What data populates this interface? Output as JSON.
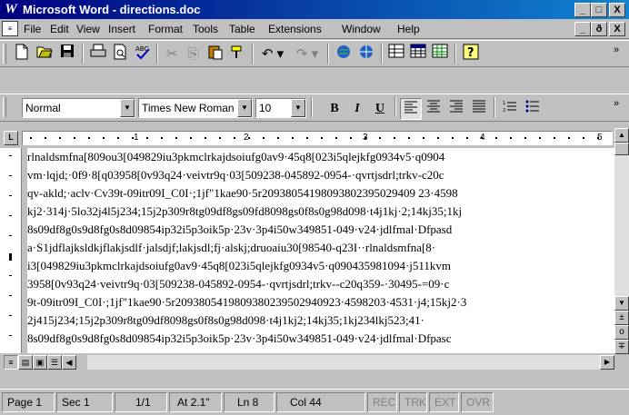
{
  "window": {
    "app_icon_glyph": "W",
    "title": "Microsoft Word - directions.doc",
    "title_buttons": {
      "minimize": "_",
      "maximize": "□",
      "close": "X"
    }
  },
  "menubar": {
    "items": [
      "File",
      "Edit",
      "View",
      "Insert",
      "Format",
      "Tools",
      "Table",
      "Extensions",
      "Window",
      "Help"
    ],
    "doc_buttons": {
      "minimize": "_",
      "restore": "ð",
      "close": "X"
    }
  },
  "standard_toolbar": {
    "icons": [
      "new-document-icon",
      "open-folder-icon",
      "save-disk-icon",
      "print-icon",
      "print-preview-icon",
      "spelling-check-icon",
      "cut-icon",
      "copy-icon",
      "paste-icon",
      "format-painter-icon",
      "undo-icon",
      "redo-icon",
      "insert-hyperlink-icon",
      "web-toolbar-icon",
      "tables-borders-icon",
      "insert-table-icon",
      "insert-excel-icon",
      "help-icon"
    ],
    "overflow": "»"
  },
  "formatting_toolbar": {
    "style": "Normal",
    "font": "Times New Roman",
    "size": "10",
    "bold": "B",
    "italic": "I",
    "underline": "U",
    "overflow": "»"
  },
  "ruler": {
    "numbers": [
      "1",
      "2",
      "3",
      "4",
      "5"
    ]
  },
  "document": {
    "lines": [
      "rlnaldsmfna[809ou3[049829iu3pkmclrkajdsoiufg0av9·45q8[023i5qlejkfg0934v5·q0904",
      "vm·lqjd;·0f9·8[q03958[0v93q24·veivtr9q·03[509238-045892-0954-·qvrtjsdrl;trkv-c20c",
      "qv-akld;·aclv·Cv39t-09itr09I_C0I·;1jf\"1kae90·5r20938054198093802395029409 23·4598",
      "kj2·314j·5lo32j4l5j234;15j2p309r8tg09df8gs09fd8098gs0f8s0g98d098·t4j1kj·2;14kj35;1kj",
      "8s09df8g0s9d8fg0s8d09854ip32i5p3oik5p·23v·3p4i50w349851-049·v24·jdlfmal·Dfpasd",
      "a·S1jdflajksldkjflakjsdlf·jalsdjf;lakjsdl;fj·alskj;druoaiu30[98540-q23I··rlnaldsmfna[8·",
      "i3[049829iu3pkmclrkajdsoiufg0av9·45q8[023i5qlejkfg0934v5·q090435981094·j511kvm",
      "3958[0v93q24·veivtr9q·03[509238-045892-0954-·qvrtjsdrl;trkv--c20q359-·30495-=09·c",
      "9t-09itr09I_C0I·;1jf\"1kae90·5r2093805419809380239502940923·4598203·4531·j4;15kj2·3",
      "2j415j234;15j2p309r8tg09df8098gs0f8s0g98d098·t4j1kj2;14kj35;1kj234lkj523;41·",
      "8s09df8g0s9d8fg0s8d09854ip32i5p3oik5p·23v·3p4i50w349851-049·v24·jdlfmal·Dfpasc"
    ]
  },
  "scrollbars": {
    "up": "▲",
    "down": "▼",
    "left": "◀",
    "right": "▶",
    "prev_page": "±",
    "select_browse": "o",
    "next_page": "∓"
  },
  "view_buttons": [
    "normal-view-icon",
    "web-layout-view-icon",
    "print-layout-view-icon",
    "outline-view-icon"
  ],
  "statusbar": {
    "page": "Page 1",
    "section": "Sec 1",
    "page_of": "1/1",
    "at": "At 2.1\"",
    "line": "Ln 8",
    "col": "Col 44",
    "rec": "REC",
    "trk": "TRK",
    "ext": "EXT",
    "ovr": "OVR"
  },
  "colors": {
    "title_gradient_start": "#000080",
    "title_gradient_end": "#1084d0",
    "face": "#c0c0c0"
  }
}
